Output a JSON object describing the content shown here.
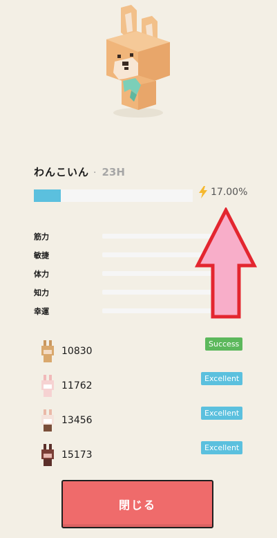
{
  "character": {
    "name": "わんこいん",
    "separator": "·",
    "age": "23H",
    "progress": 0.17,
    "progress_label": "17.00%",
    "accent": "#5bc0de"
  },
  "stats": [
    {
      "label": "筋力"
    },
    {
      "label": "敏捷"
    },
    {
      "label": "体力"
    },
    {
      "label": "知力"
    },
    {
      "label": "幸運"
    }
  ],
  "entries": [
    {
      "id": "10830",
      "result": "Success",
      "color": "#5cb85c"
    },
    {
      "id": "11762",
      "result": "Excellent",
      "color": "#5bc0de"
    },
    {
      "id": "13456",
      "result": "Excellent",
      "color": "#5bc0de"
    },
    {
      "id": "15173",
      "result": "Excellent",
      "color": "#5bc0de"
    }
  ],
  "close_button": {
    "label": "閉じる",
    "color": "#ef6b6b"
  }
}
